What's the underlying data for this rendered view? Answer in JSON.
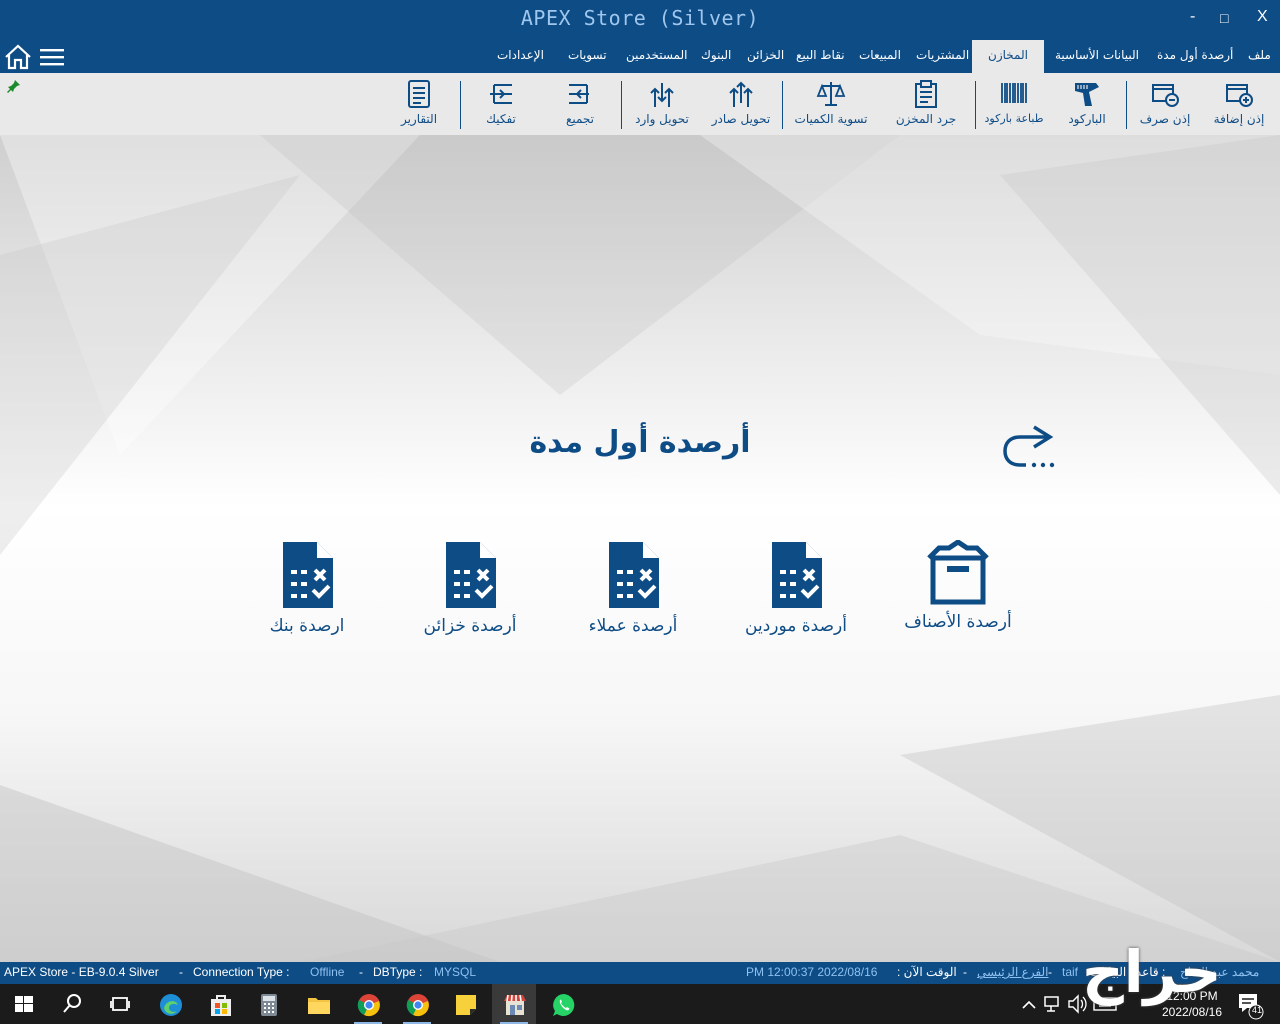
{
  "window": {
    "title": "APEX Store (Silver)",
    "minimize": "-",
    "maximize": "□",
    "close": "X"
  },
  "tabs": [
    {
      "label": "ملف"
    },
    {
      "label": "أرصدة أول مدة"
    },
    {
      "label": "البيانات الأساسية"
    },
    {
      "label": "المخازن",
      "active": true
    },
    {
      "label": "المشتريات"
    },
    {
      "label": "المبيعات"
    },
    {
      "label": "نقاط البيع"
    },
    {
      "label": "الخزائن"
    },
    {
      "label": "البنوك"
    },
    {
      "label": "المستخدمين"
    },
    {
      "label": "تسويات"
    },
    {
      "label": "الإعدادات"
    }
  ],
  "toolbar": [
    {
      "label": "إذن إضافة",
      "icon": "add-permit-icon"
    },
    {
      "label": "إذن صرف",
      "icon": "dispense-permit-icon"
    },
    {
      "label": "الباركود",
      "icon": "barcode-scanner-icon"
    },
    {
      "label": "طباعة باركود",
      "icon": "barcode-icon"
    },
    {
      "label": "جرد المخزن",
      "icon": "inventory-clipboard-icon"
    },
    {
      "label": "تسوية الكميات",
      "icon": "balance-scale-icon"
    },
    {
      "label": "تحويل صادر",
      "icon": "transfer-out-icon"
    },
    {
      "label": "تحويل وارد",
      "icon": "transfer-in-icon"
    },
    {
      "label": "تجميع",
      "icon": "assemble-icon"
    },
    {
      "label": "تفكيك",
      "icon": "disassemble-icon"
    },
    {
      "label": "التقارير",
      "icon": "reports-icon"
    }
  ],
  "main": {
    "title": "أرصدة أول مدة",
    "tiles": [
      {
        "label": "أرصدة الأصناف",
        "icon": "box-icon"
      },
      {
        "label": "أرصدة موردين",
        "icon": "document-check-icon"
      },
      {
        "label": "أرصدة عملاء",
        "icon": "document-check-icon"
      },
      {
        "label": "أرصدة خزائن",
        "icon": "document-check-icon"
      },
      {
        "label": "ارصدة بنك",
        "icon": "document-check-icon"
      }
    ]
  },
  "status": {
    "app": "APEX Store - EB-9.0.4 Silver",
    "sep": "-",
    "conn_label": "Connection Type :",
    "conn_value": "Offline",
    "db_label": "DBType :",
    "db_value": "MYSQL",
    "datetime": "PM 12:00:37 2022/08/16",
    "now_label": "الوقت الآن :",
    "branch": "الفرع الرئيسي",
    "user": "taif",
    "data_label": ": قاعدة البيانات",
    "owner": "محمد عبد الفتاح"
  },
  "taskbar": {
    "time": "12:00 PM",
    "date": "2022/08/16",
    "notifications": "41"
  },
  "watermark": "حراج",
  "colors": {
    "brand": "#0e4c86",
    "toolbar_bg": "#e9e9e9",
    "taskbar_bg": "#1b1b1b"
  }
}
